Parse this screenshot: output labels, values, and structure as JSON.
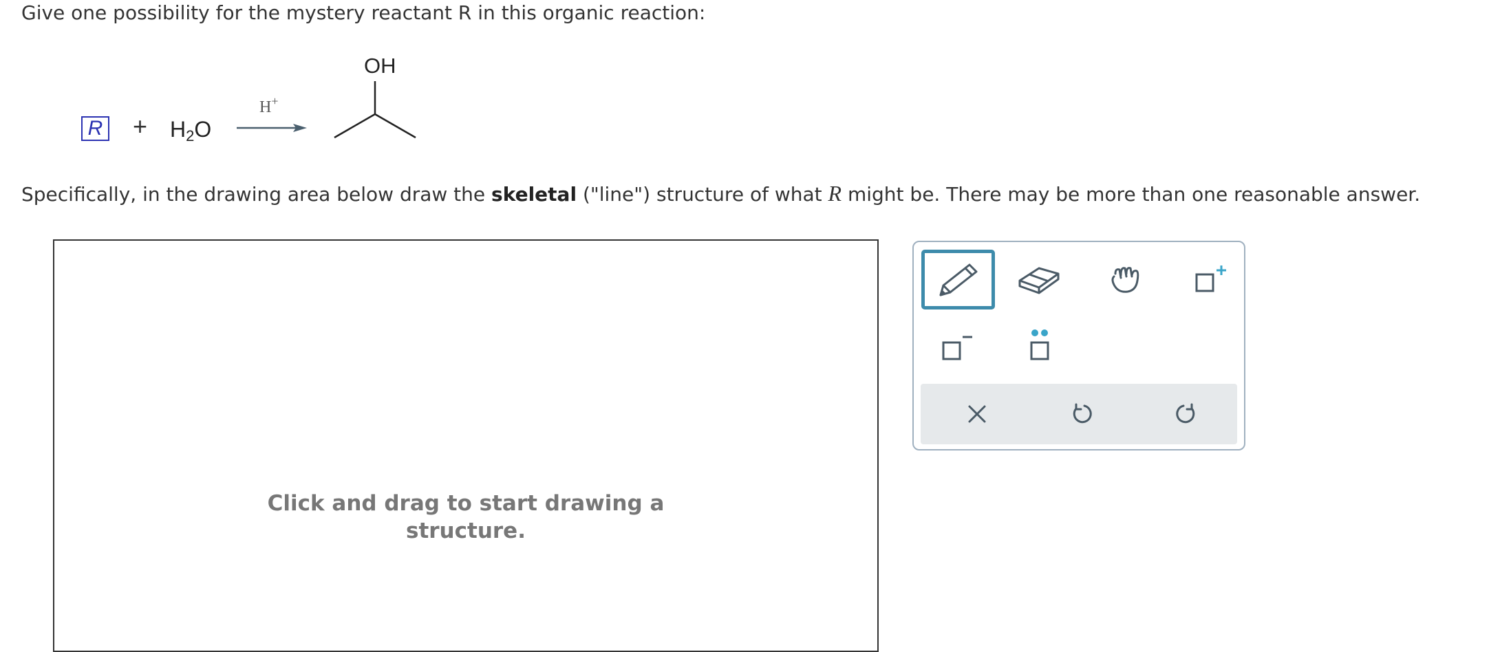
{
  "question": {
    "prompt": "Give one possibility for the mystery reactant R in this organic reaction:",
    "instruction_before": "Specifically, in the drawing area below draw the ",
    "instruction_bold": "skeletal",
    "instruction_middle": " (\"line\") structure of what ",
    "instruction_var": "R",
    "instruction_after": " might be. There may be more than one reasonable answer."
  },
  "reaction": {
    "reactant_label": "R",
    "plus": "+",
    "reagent_main": "H",
    "reagent_sub": "2",
    "reagent_tail": "O",
    "condition_main": "H",
    "condition_sup": "+",
    "product_group": "OH"
  },
  "drawing_area": {
    "hint_line1": "Click and drag to start drawing a",
    "hint_line2": "structure."
  },
  "toolbar": {
    "tools": [
      {
        "name": "pencil-tool",
        "icon": "pencil-icon",
        "selected": true
      },
      {
        "name": "eraser-tool",
        "icon": "eraser-icon",
        "selected": false
      },
      {
        "name": "hand-tool",
        "icon": "hand-icon",
        "selected": false
      },
      {
        "name": "positive-charge-tool",
        "icon": "positive-charge-icon",
        "selected": false
      },
      {
        "name": "negative-charge-tool",
        "icon": "negative-charge-icon",
        "selected": false
      },
      {
        "name": "lone-pair-tool",
        "icon": "lone-pair-icon",
        "selected": false
      }
    ],
    "actions": [
      {
        "name": "clear-button",
        "icon": "close-icon"
      },
      {
        "name": "undo-button",
        "icon": "undo-icon"
      },
      {
        "name": "redo-button",
        "icon": "redo-icon"
      }
    ]
  },
  "colors": {
    "reactant_box": "#2b32b2",
    "accent": "#3d8bab",
    "icon": "#4a5a66",
    "charge": "#3aa5c9",
    "action_bar": "#e6e9eb",
    "toolbar_border": "#9fb0bf",
    "arrow": "#4a5f6e"
  }
}
